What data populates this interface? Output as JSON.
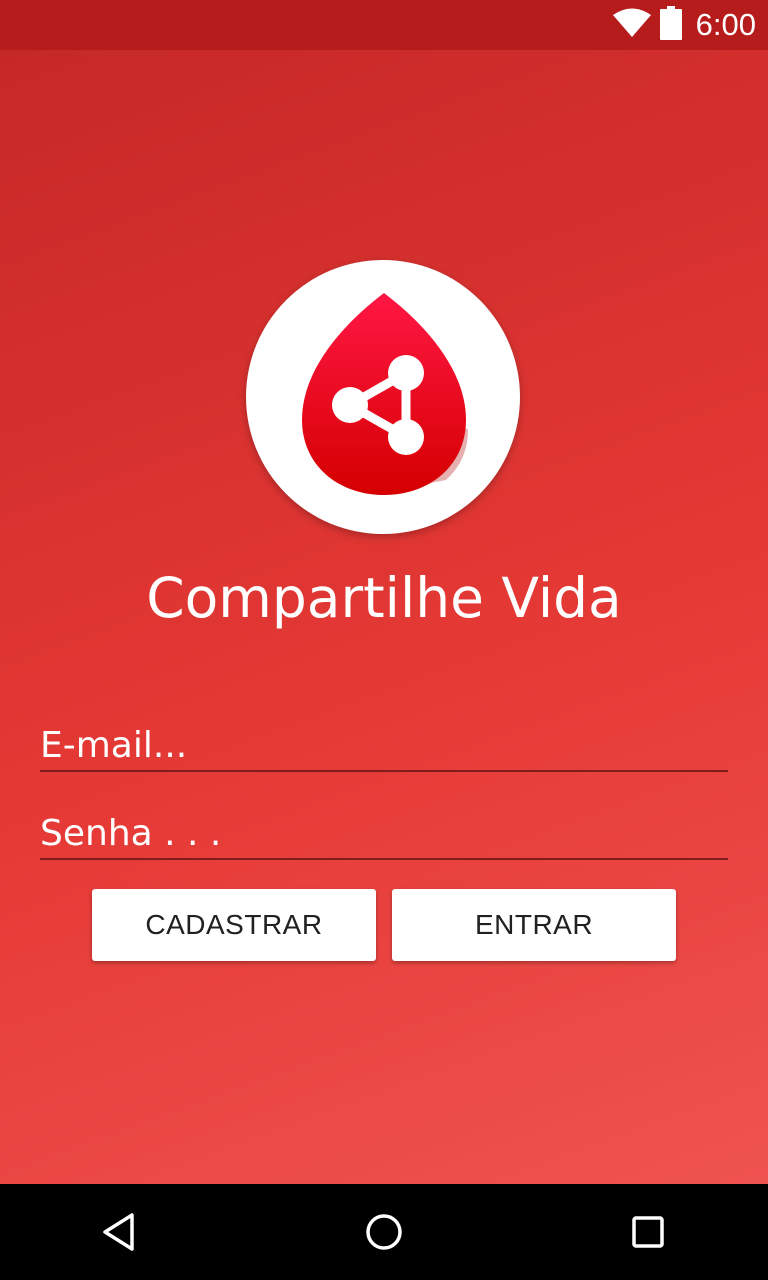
{
  "status_bar": {
    "time": "6:00",
    "icons": [
      "wifi-icon",
      "battery-icon"
    ]
  },
  "app": {
    "title": "Compartilhe Vida",
    "logo_icon": "blood-drop-share-icon",
    "colors": {
      "primary": "#e53935",
      "primary_dark": "#b71c1c",
      "logo_red": "#d50000"
    }
  },
  "form": {
    "email_placeholder": "E-mail...",
    "email_value": "",
    "password_placeholder": "Senha . . .",
    "password_value": ""
  },
  "buttons": {
    "register_label": "CADASTRAR",
    "login_label": "ENTRAR"
  },
  "nav_bar": {
    "icons": [
      "back-icon",
      "home-icon",
      "recents-icon"
    ]
  }
}
